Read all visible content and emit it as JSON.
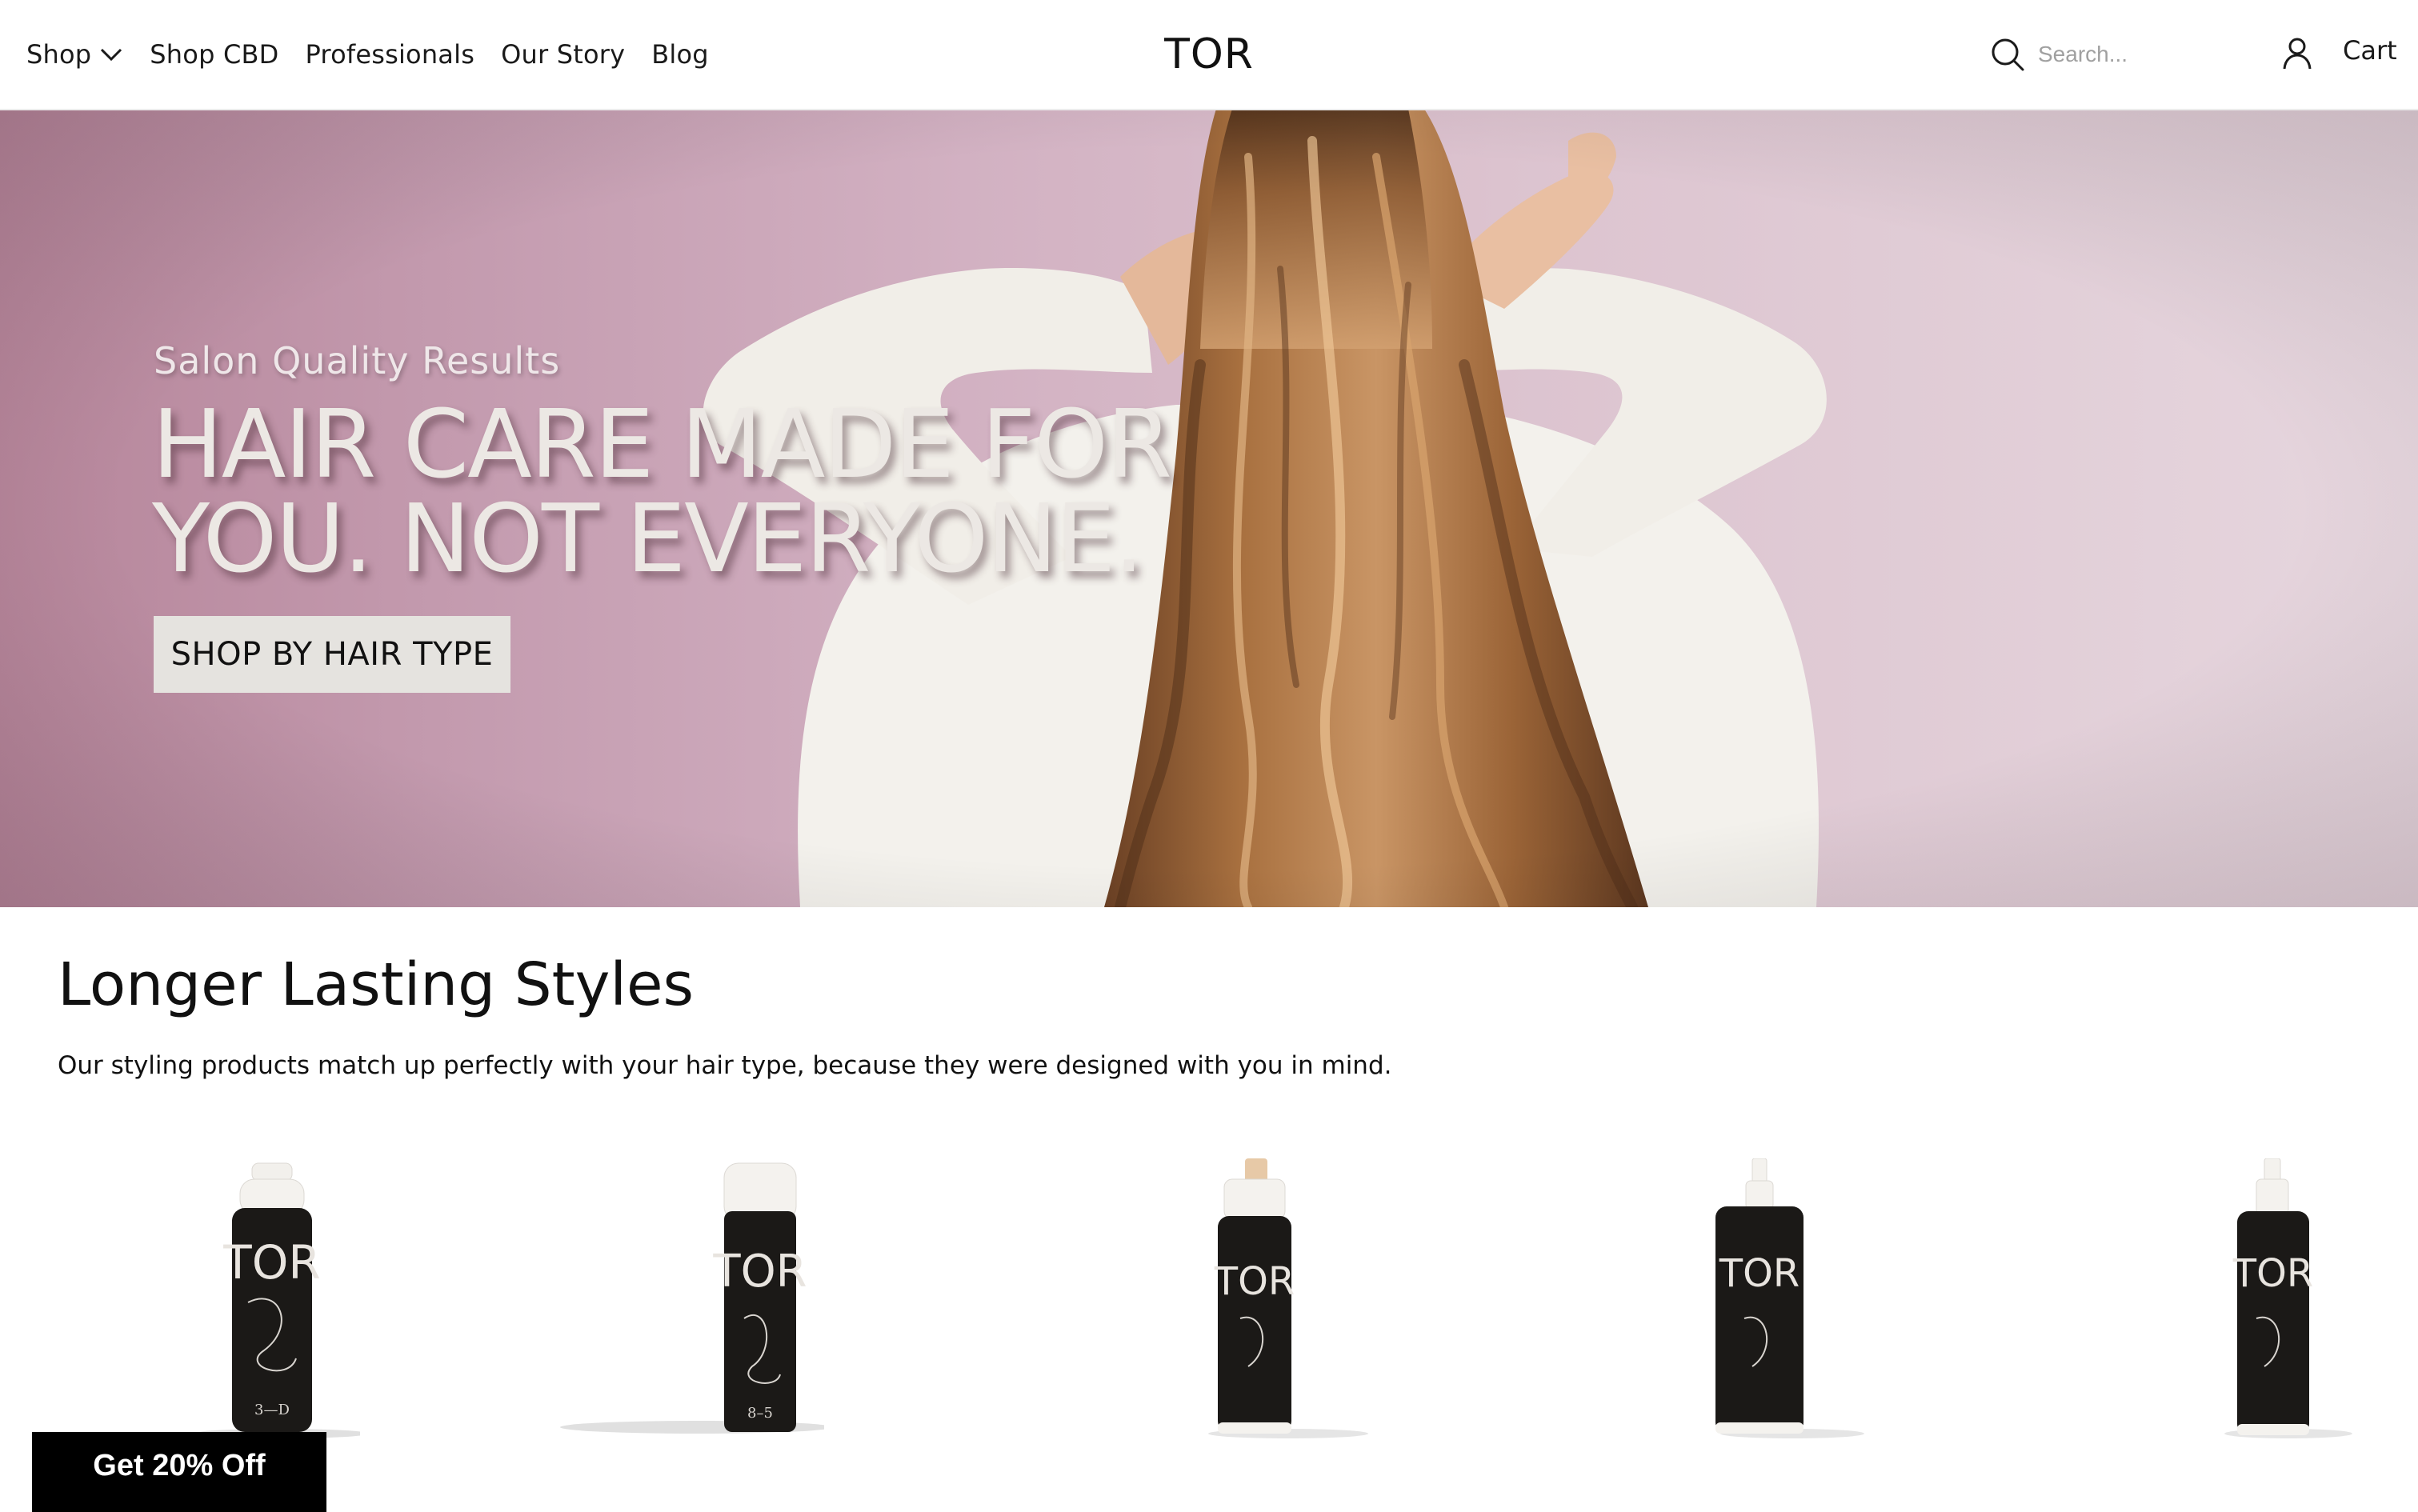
{
  "header": {
    "nav": [
      {
        "label": "Shop",
        "has_dropdown": true
      },
      {
        "label": "Shop CBD"
      },
      {
        "label": "Professionals"
      },
      {
        "label": "Our Story"
      },
      {
        "label": "Blog"
      }
    ],
    "logo": "TOR",
    "search": {
      "placeholder": "Search...",
      "icon": "search-icon"
    },
    "account_icon": "user-icon",
    "cart_label": "Cart"
  },
  "hero": {
    "subtitle": "Salon Quality Results",
    "title": "HAIR CARE MADE FOR YOU. NOT EVERYONE.",
    "cta_label": "SHOP BY HAIR TYPE"
  },
  "section": {
    "title": "Longer Lasting Styles",
    "description": "Our styling products match up perfectly with your hair type, because they were designed with you in mind."
  },
  "products": [
    {
      "brand": "TOR",
      "code": "3—D",
      "type": "pump bottle"
    },
    {
      "brand": "TOR",
      "code": "8–5",
      "type": "airless pump"
    },
    {
      "brand": "TOR",
      "code": "",
      "type": "foam pump"
    },
    {
      "brand": "TOR",
      "code": "",
      "type": "spray bottle"
    },
    {
      "brand": "TOR",
      "code": "",
      "type": "dropper bottle"
    }
  ],
  "promo_label": "Get 20% Off",
  "colors": {
    "hero_bg": "#c9a2b5",
    "button_bg": "#e5e3df",
    "promo_bg": "#000000"
  }
}
